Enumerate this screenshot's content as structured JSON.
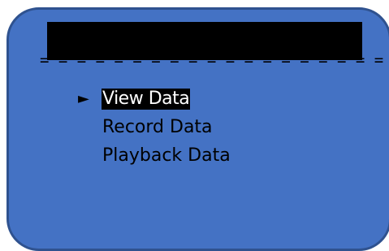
{
  "title": "",
  "separator": "= = = = = = = = = = = = = = = = = = = = =",
  "menu": {
    "cursor_icon": "right-triangle-icon",
    "cursor_glyph": "►",
    "items": [
      {
        "label": "View Data",
        "selected": true
      },
      {
        "label": "Record Data",
        "selected": false
      },
      {
        "label": "Playback Data",
        "selected": false
      }
    ]
  },
  "colors": {
    "screen_bg": "#4472c4",
    "screen_border": "#2f528f",
    "title_bar": "#000000",
    "highlight_bg": "#000000",
    "highlight_text": "#ffffff"
  }
}
